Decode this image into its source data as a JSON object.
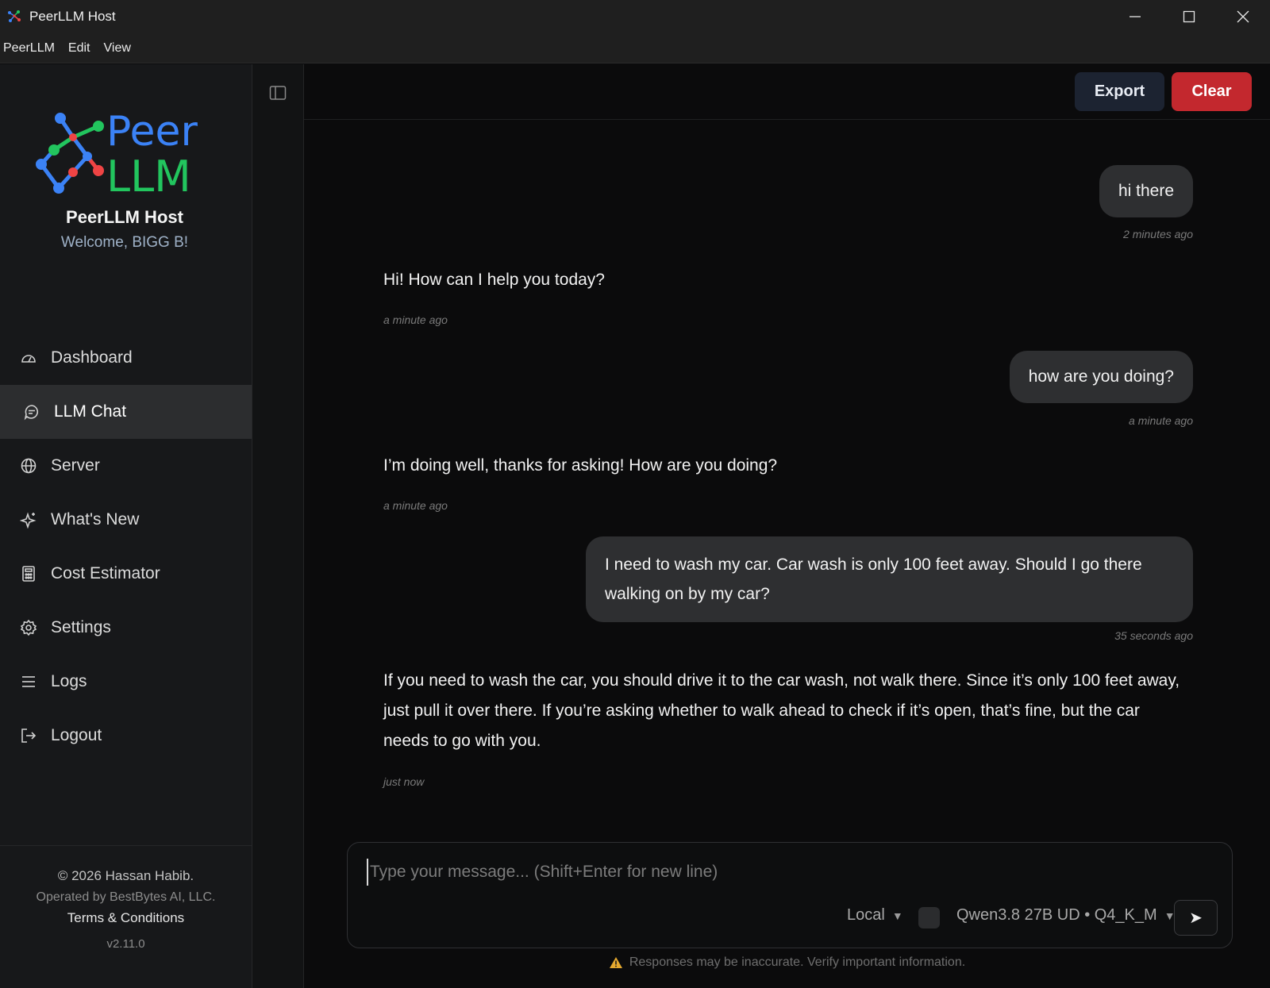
{
  "window": {
    "title": "PeerLLM Host"
  },
  "menubar": {
    "items": [
      "PeerLLM",
      "Edit",
      "View"
    ]
  },
  "sidebar": {
    "logo": {
      "line1": "Peer",
      "line2": "LLM"
    },
    "title": "PeerLLM Host",
    "welcome": "Welcome, BIGG B!",
    "items": [
      {
        "label": "Dashboard",
        "icon": "gauge-icon"
      },
      {
        "label": "LLM Chat",
        "icon": "chat-bubble-icon",
        "active": true
      },
      {
        "label": "Server",
        "icon": "globe-icon"
      },
      {
        "label": "What's New",
        "icon": "sparkle-icon"
      },
      {
        "label": "Cost Estimator",
        "icon": "calculator-icon"
      },
      {
        "label": "Settings",
        "icon": "gear-icon"
      },
      {
        "label": "Logs",
        "icon": "menu-lines-icon"
      },
      {
        "label": "Logout",
        "icon": "logout-icon"
      }
    ],
    "footer": {
      "copyright": "© 2026 Hassan Habib.",
      "operated": "Operated by BestBytes AI, LLC.",
      "terms": "Terms & Conditions",
      "version": "v2.11.0"
    }
  },
  "header": {
    "export_label": "Export",
    "clear_label": "Clear"
  },
  "chat": {
    "messages": [
      {
        "role": "user",
        "text": "hi there",
        "time": "2 minutes ago"
      },
      {
        "role": "assistant",
        "text": "Hi! How can I help you today?",
        "time": "a minute ago"
      },
      {
        "role": "user",
        "text": "how are you doing?",
        "time": "a minute ago"
      },
      {
        "role": "assistant",
        "text": "I’m doing well, thanks for asking! How are you doing?",
        "time": "a minute ago"
      },
      {
        "role": "user",
        "text": "I need to wash my car. Car wash is only 100 feet away. Should I go there walking on by my car?",
        "time": "35 seconds ago"
      },
      {
        "role": "assistant",
        "text": "If you need to wash the car, you should drive it to the car wash, not walk there. Since it’s only 100 feet away, just pull it over there. If you’re asking whether to walk ahead to check if it’s open, that’s fine, but the car needs to go with you.",
        "time": "just now"
      }
    ]
  },
  "composer": {
    "placeholder": "Type your message... (Shift+Enter for new line)",
    "value": "",
    "mode": "Local",
    "model": "Qwen3.8 27B UD • Q4_K_M",
    "caret": "▼",
    "send_glyph": "➤"
  },
  "disclaimer": "Responses may be inaccurate. Verify important information.",
  "colors": {
    "accent_red": "#c3282e",
    "export_bg": "#1c2331",
    "logo_blue": "#3b82f6",
    "logo_green": "#22c55e",
    "logo_red": "#ef4444"
  }
}
